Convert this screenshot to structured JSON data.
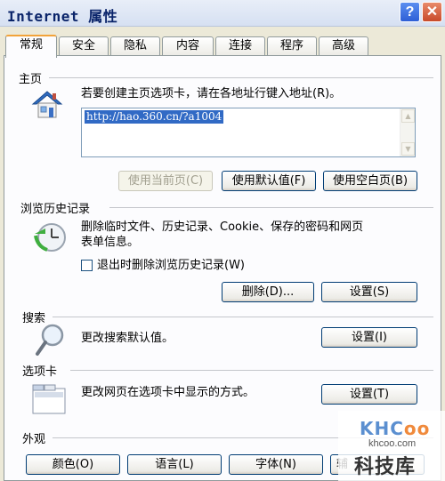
{
  "window": {
    "title": "Internet 属性",
    "help_label": "?",
    "close_label": "✕"
  },
  "tabs": [
    {
      "label": "常规",
      "active": true
    },
    {
      "label": "安全"
    },
    {
      "label": "隐私"
    },
    {
      "label": "内容"
    },
    {
      "label": "连接"
    },
    {
      "label": "程序"
    },
    {
      "label": "高级"
    }
  ],
  "homepage": {
    "section_title": "主页",
    "description": "若要创建主页选项卡，请在各地址行键入地址(R)。",
    "url_value": "http://hao.360.cn/?a1004",
    "use_current_label": "使用当前页(C)",
    "use_default_label": "使用默认值(F)",
    "use_blank_label": "使用空白页(B)"
  },
  "history": {
    "section_title": "浏览历史记录",
    "description_line1": "删除临时文件、历史记录、Cookie、保存的密码和网页",
    "description_line2": "表单信息。",
    "checkbox_label": "退出时删除浏览历史记录(W)",
    "checkbox_checked": false,
    "delete_label": "删除(D)...",
    "settings_label": "设置(S)"
  },
  "search": {
    "section_title": "搜索",
    "description": "更改搜索默认值。",
    "settings_label": "设置(I)"
  },
  "tabs_section": {
    "section_title": "选项卡",
    "description": "更改网页在选项卡中显示的方式。",
    "settings_label": "设置(T)"
  },
  "appearance": {
    "section_title": "外观",
    "colors_label": "颜色(O)",
    "languages_label": "语言(L)",
    "fonts_label": "字体(N)",
    "accessibility_label": "辅"
  },
  "watermark": {
    "logo_text_1": "KHC",
    "logo_text_2": "oo",
    "site": "khcoo.com",
    "name": "科技库"
  },
  "icons": {
    "home": "home-icon",
    "history": "history-clock-icon",
    "search": "magnifier-icon",
    "tabs": "tabs-window-icon"
  }
}
